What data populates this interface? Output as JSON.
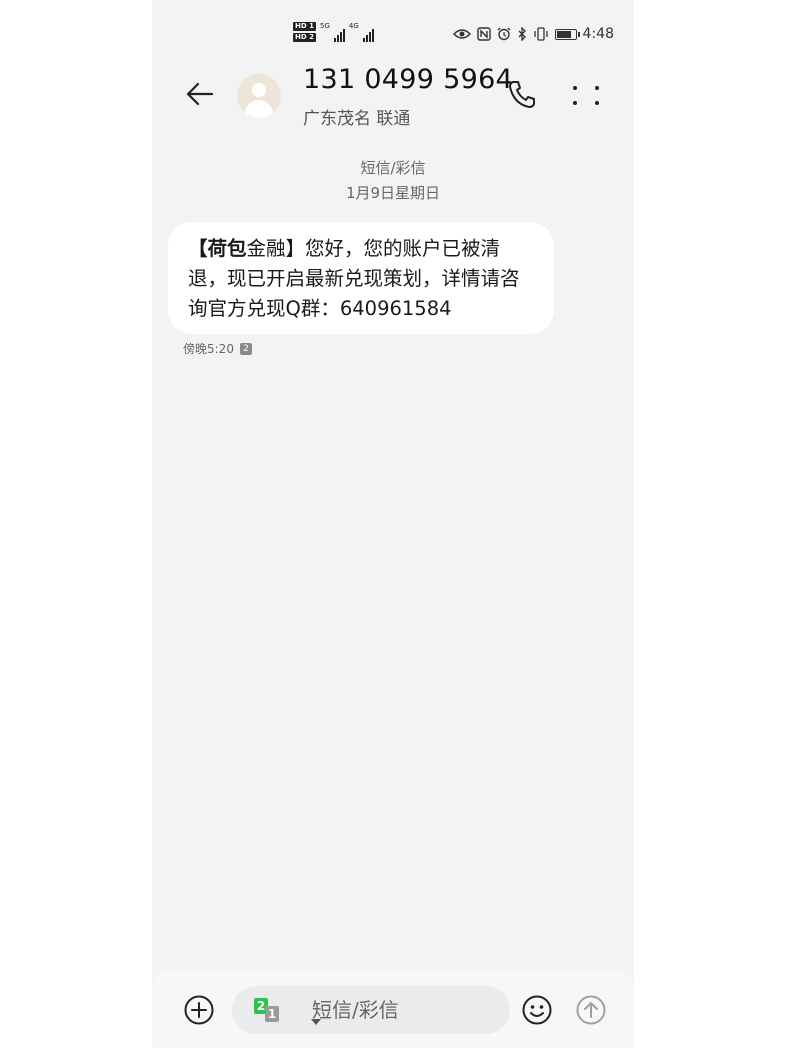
{
  "status_bar": {
    "hd_top": "HD 1",
    "hd_bottom": "HD 2",
    "net1": "5G",
    "net2": "4G",
    "time": "4:48",
    "icons": [
      "eye-icon",
      "nfc-icon",
      "alarm-icon",
      "bluetooth-icon",
      "vibrate-icon",
      "battery-icon"
    ]
  },
  "header": {
    "contact_number": "131 0499 5964",
    "contact_location": "广东茂名 联通"
  },
  "thread": {
    "type_label": "短信/彩信",
    "date_label": "1月9日星期日"
  },
  "message": {
    "bold_prefix": "【荷包",
    "body": "金融】您好，您的账户已被清退，现已开启最新兑现策划，详情请咨询官方兑现Q群：640961584",
    "time": "傍晚5:20",
    "sim_badge": "2"
  },
  "compose": {
    "sim_front": "2",
    "sim_back": "1",
    "placeholder": "短信/彩信"
  }
}
